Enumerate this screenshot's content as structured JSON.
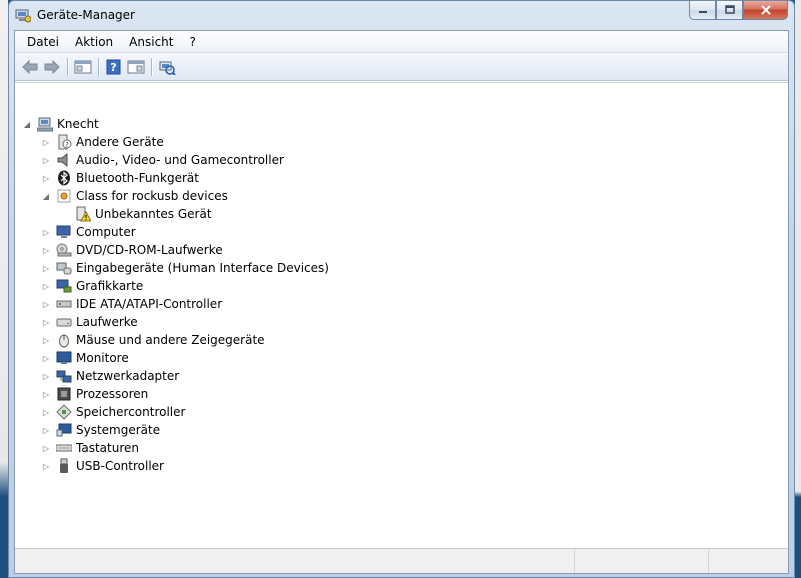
{
  "window": {
    "title": "Geräte-Manager"
  },
  "menu": [
    {
      "id": "datei",
      "label": "Datei"
    },
    {
      "id": "aktion",
      "label": "Aktion"
    },
    {
      "id": "ansicht",
      "label": "Ansicht"
    },
    {
      "id": "hilfe",
      "label": "?"
    }
  ],
  "toolbar": [
    {
      "id": "back",
      "icon": "back-arrow-icon"
    },
    {
      "id": "forward",
      "icon": "forward-arrow-icon"
    },
    {
      "id": "console-tree",
      "icon": "console-tree-icon"
    },
    {
      "id": "help",
      "icon": "help-icon"
    },
    {
      "id": "action-pane",
      "icon": "action-pane-icon"
    },
    {
      "id": "scan-hardware",
      "icon": "scan-hardware-icon"
    }
  ],
  "tree": {
    "root": {
      "label": "Knecht",
      "icon": "computer-network-icon",
      "expanded": true
    },
    "items": [
      {
        "label": "Andere Geräte",
        "icon": "unknown-device-icon",
        "expanded": false,
        "level": 1
      },
      {
        "label": "Audio-, Video- und Gamecontroller",
        "icon": "speaker-icon",
        "expanded": false,
        "level": 1
      },
      {
        "label": "Bluetooth-Funkgerät",
        "icon": "bluetooth-icon",
        "expanded": false,
        "level": 1
      },
      {
        "label": "Class for rockusb devices",
        "icon": "device-class-icon",
        "expanded": true,
        "level": 1
      },
      {
        "label": "Unbekanntes Gerät",
        "icon": "warning-device-icon",
        "expanded": null,
        "level": 2
      },
      {
        "label": "Computer",
        "icon": "monitor-icon",
        "expanded": false,
        "level": 1
      },
      {
        "label": "DVD/CD-ROM-Laufwerke",
        "icon": "dvd-drive-icon",
        "expanded": false,
        "level": 1
      },
      {
        "label": "Eingabegeräte (Human Interface Devices)",
        "icon": "hid-icon",
        "expanded": false,
        "level": 1
      },
      {
        "label": "Grafikkarte",
        "icon": "graphics-card-icon",
        "expanded": false,
        "level": 1
      },
      {
        "label": "IDE ATA/ATAPI-Controller",
        "icon": "ide-controller-icon",
        "expanded": false,
        "level": 1
      },
      {
        "label": "Laufwerke",
        "icon": "disk-drive-icon",
        "expanded": false,
        "level": 1
      },
      {
        "label": "Mäuse und andere Zeigegeräte",
        "icon": "mouse-icon",
        "expanded": false,
        "level": 1
      },
      {
        "label": "Monitore",
        "icon": "monitor-icon",
        "expanded": false,
        "level": 1
      },
      {
        "label": "Netzwerkadapter",
        "icon": "network-adapter-icon",
        "expanded": false,
        "level": 1
      },
      {
        "label": "Prozessoren",
        "icon": "processor-icon",
        "expanded": false,
        "level": 1
      },
      {
        "label": "Speichercontroller",
        "icon": "storage-controller-icon",
        "expanded": false,
        "level": 1
      },
      {
        "label": "Systemgeräte",
        "icon": "system-devices-icon",
        "expanded": false,
        "level": 1
      },
      {
        "label": "Tastaturen",
        "icon": "keyboard-icon",
        "expanded": false,
        "level": 1
      },
      {
        "label": "USB-Controller",
        "icon": "usb-icon",
        "expanded": false,
        "level": 1
      }
    ]
  },
  "colors": {
    "titlebar": "#c6d6ea",
    "close_button": "#c2442b",
    "tree_background": "#ffffff"
  }
}
